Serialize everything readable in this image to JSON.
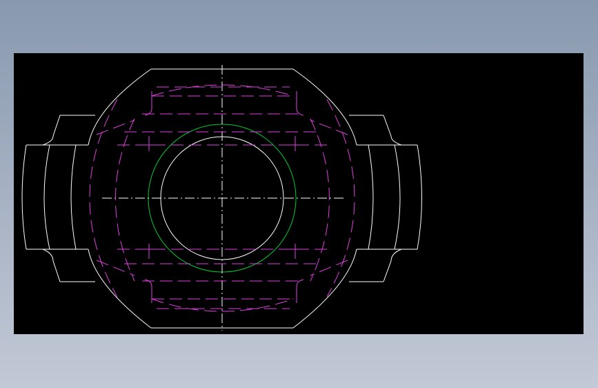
{
  "colors": {
    "background_top": "#8899ae",
    "background_bottom": "#c2c9d6",
    "viewport": "#000000",
    "outline": "#ffffff",
    "hidden_lines": "#e040e0",
    "bore_circle": "#00cc33",
    "center_lines": "#ffffff"
  },
  "drawing": {
    "line_types": [
      "solid",
      "dashed",
      "dash-dot"
    ],
    "icons": [
      "cad-viewport"
    ]
  }
}
